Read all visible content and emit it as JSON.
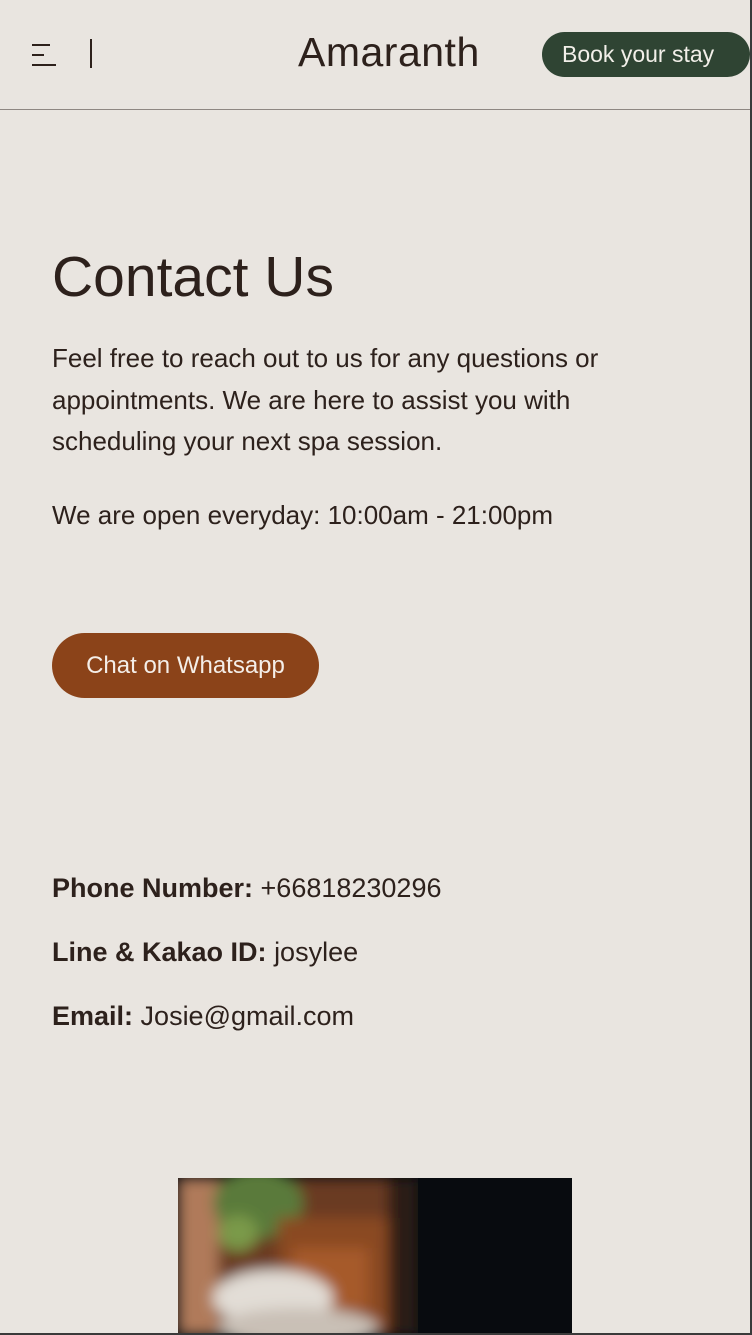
{
  "header": {
    "brand": "Amaranth",
    "book_label": "Book your stay",
    "menu_icon": "hamburger-menu-icon"
  },
  "main": {
    "title": "Contact Us",
    "intro": "Feel free to reach out to us for any questions or appointments. We are here to assist you with scheduling your next spa session.",
    "hours": "We are open everyday: 10:00am - 21:00pm",
    "whatsapp_label": "Chat on Whatsapp"
  },
  "contact": {
    "phone_label": "Phone Number:",
    "phone_value": "+66818230296",
    "id_label": "Line & Kakao ID:",
    "id_value": "josylee",
    "email_label": "Email:",
    "email_value": "Josie@gmail.com"
  },
  "colors": {
    "background": "#e9e5e0",
    "text": "#2d211c",
    "book_button": "#2f4433",
    "whatsapp_button": "#8b4319"
  }
}
